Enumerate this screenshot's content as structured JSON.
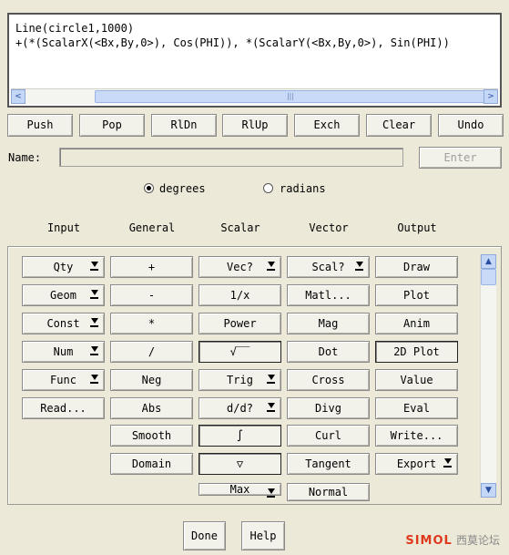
{
  "expression": {
    "lines": [
      "Line(circle1,1000)",
      "+(*(ScalarX(<Bx,By,0>), Cos(PHI)), *(ScalarY(<Bx,By,0>), Sin(PHI))"
    ],
    "scroll_left": "<",
    "scroll_right": ">",
    "thumb_grip": "|||"
  },
  "stack_buttons": [
    "Push",
    "Pop",
    "RlDn",
    "RlUp",
    "Exch",
    "Clear",
    "Undo"
  ],
  "name_label": "Name:",
  "enter_label": "Enter",
  "angle_mode": {
    "degrees": "degrees",
    "radians": "radians",
    "selected": "degrees"
  },
  "columns": [
    "Input",
    "General",
    "Scalar",
    "Vector",
    "Output"
  ],
  "input_buttons": [
    "Qty",
    "Geom",
    "Const",
    "Num",
    "Func",
    "Read..."
  ],
  "general_buttons": [
    "+",
    "-",
    "*",
    "/",
    "Neg",
    "Abs",
    "Smooth",
    "Domain"
  ],
  "scalar_buttons": [
    "Vec?",
    "1/x",
    "Power",
    "√‾‾",
    "Trig",
    "d/d?",
    "∫",
    "▽",
    "Max"
  ],
  "vector_buttons": [
    "Scal?",
    "Matl...",
    "Mag",
    "Dot",
    "Cross",
    "Divg",
    "Curl",
    "Tangent",
    "Normal"
  ],
  "output_buttons": [
    "Draw",
    "Plot",
    "Anim",
    "2D Plot",
    "Value",
    "Eval",
    "Write...",
    "Export"
  ],
  "done_label": "Done",
  "help_label": "Help",
  "footer": {
    "brand": "SIMOL",
    "sub": "西莫论坛"
  }
}
